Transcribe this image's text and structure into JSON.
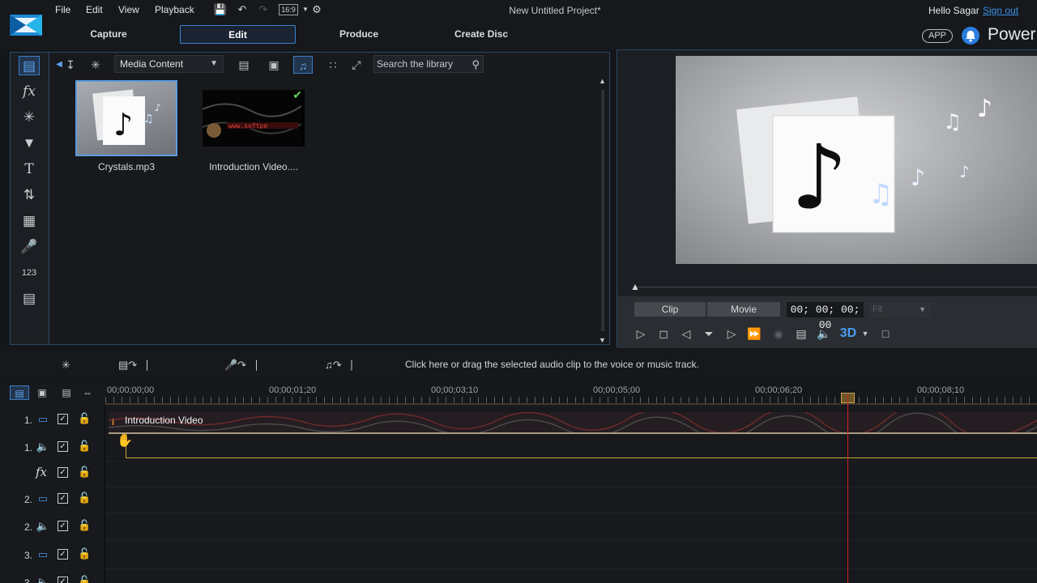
{
  "menu": {
    "file": "File",
    "edit": "Edit",
    "view": "View",
    "playback": "Playback",
    "aspect": "16:9"
  },
  "project_title": "New Untitled Project*",
  "user": {
    "hello": "Hello Sagar",
    "signout": "Sign out",
    "app_badge": "APP",
    "brand": "Power"
  },
  "main_tabs": [
    "Capture",
    "Edit",
    "Produce",
    "Create Disc"
  ],
  "library": {
    "content_select": "Media Content",
    "search_placeholder": "Search the library",
    "clips": [
      {
        "label": "Crystals.mp3"
      },
      {
        "label": "Introduction Video...."
      }
    ]
  },
  "preview": {
    "mode_clip": "Clip",
    "mode_movie": "Movie",
    "timecode": "00; 00; 00; 00",
    "fit": "Fit",
    "btn_3d": "3D"
  },
  "timeline": {
    "hint": "Click here or drag the selected audio clip to the voice or music track.",
    "ruler_labels": [
      "00;00;00;00",
      "00;00;01;20",
      "00;00;03;10",
      "00;00;05;00",
      "00;00;06;20",
      "00;00;08;10"
    ],
    "video_clip_label": "Introduction Video",
    "tracks": [
      {
        "num": "1.",
        "type": "video"
      },
      {
        "num": "1.",
        "type": "audio"
      },
      {
        "num": "",
        "type": "fx"
      },
      {
        "num": "2.",
        "type": "video"
      },
      {
        "num": "2.",
        "type": "audio"
      },
      {
        "num": "3.",
        "type": "video"
      },
      {
        "num": "3.",
        "type": "audio"
      }
    ]
  },
  "colors": {
    "accent": "#3b82d0",
    "playhead": "#d02222",
    "highlight": "#cfa83a"
  }
}
